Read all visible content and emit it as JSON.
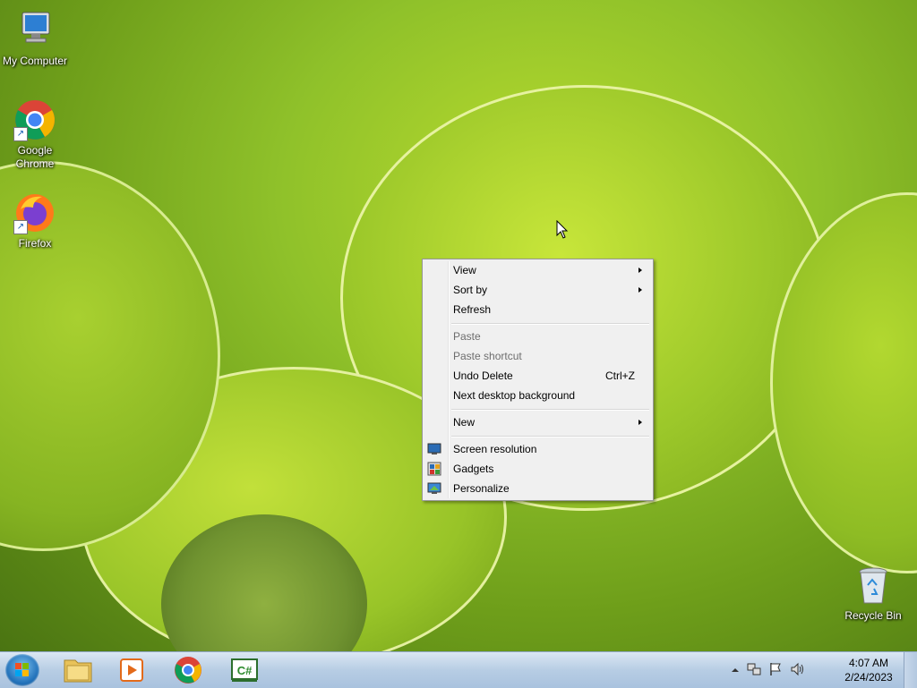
{
  "desktop": {
    "icons": [
      {
        "label": "My Computer",
        "icon": "computer-icon"
      },
      {
        "label": "Google Chrome",
        "icon": "chrome-icon"
      },
      {
        "label": "Firefox",
        "icon": "firefox-icon"
      },
      {
        "label": "Recycle Bin",
        "icon": "recycle-bin-icon"
      }
    ]
  },
  "context_menu": {
    "items": [
      {
        "label": "View",
        "submenu": true
      },
      {
        "label": "Sort by",
        "submenu": true
      },
      {
        "label": "Refresh"
      },
      {
        "label": "Paste",
        "disabled": true
      },
      {
        "label": "Paste shortcut",
        "disabled": true
      },
      {
        "label": "Undo Delete",
        "shortcut": "Ctrl+Z"
      },
      {
        "label": "Next desktop background"
      },
      {
        "label": "New",
        "submenu": true
      },
      {
        "label": "Screen resolution",
        "icon": "monitor-icon"
      },
      {
        "label": "Gadgets",
        "icon": "gadgets-icon"
      },
      {
        "label": "Personalize",
        "icon": "personalize-icon"
      }
    ]
  },
  "taskbar": {
    "pinned": [
      "file-explorer-icon",
      "media-player-icon",
      "chrome-icon",
      "csharp-icon"
    ],
    "clock": {
      "time": "4:07 AM",
      "date": "2/24/2023"
    },
    "tray": [
      "show-hidden-icons",
      "network-icon",
      "action-center-flag-icon",
      "volume-icon"
    ]
  },
  "colors": {
    "menu_bg": "#f0f0f0",
    "taskbar": "#b7cde4",
    "accent": "#1f6fb8"
  }
}
